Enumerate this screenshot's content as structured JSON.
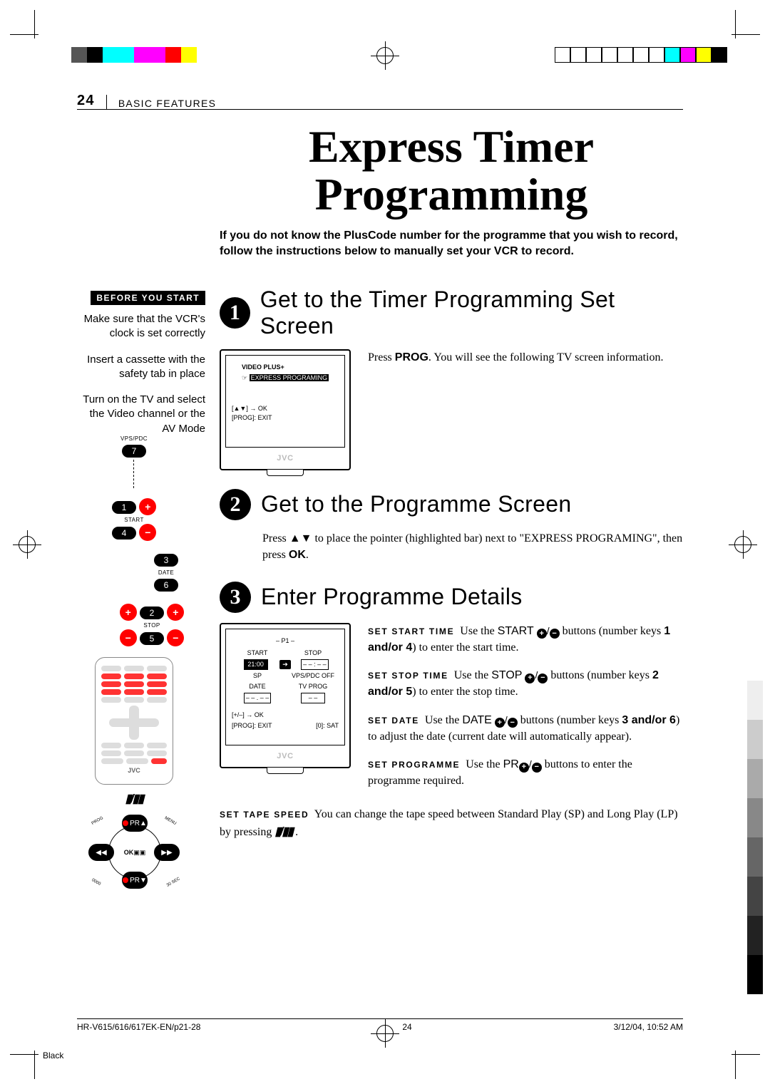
{
  "page_number": "24",
  "section": "BASIC FEATURES",
  "title_line1": "Express Timer",
  "title_line2": "Programming",
  "intro": "If you do not know the PlusCode number for the programme that you wish to record, follow the instructions below to manually set your VCR to record.",
  "before": {
    "badge": "BEFORE YOU START",
    "items": [
      "Make sure that the VCR's clock is set correctly",
      "Insert a cassette with the safety tab in place",
      "Turn on the TV and select the Video channel or the AV Mode"
    ]
  },
  "steps": {
    "s1": {
      "num": "1",
      "title": "Get to the Timer Programming Set Screen",
      "body_pre": "Press ",
      "body_kw": "PROG",
      "body_post": ". You will see the following TV screen information."
    },
    "s2": {
      "num": "2",
      "title": "Get to the Programme Screen",
      "body_pre": "Press ",
      "arrows": "▲▼",
      "body_mid": " to place the pointer (highlighted bar) next to \"EXPRESS PROGRAMING\", then press ",
      "ok": "OK",
      "body_post": "."
    },
    "s3": {
      "num": "3",
      "title": "Enter Programme Details",
      "start": {
        "label": "SET START TIME",
        "pre": "Use the  ",
        "btn": "START",
        "post": " buttons (number keys ",
        "keys": "1 and/or 4",
        "tail": ") to enter the start time."
      },
      "stop": {
        "label": "SET STOP TIME",
        "pre": "Use the ",
        "btn": "STOP",
        "post": " buttons (number keys ",
        "keys": "2 and/or 5",
        "tail": ") to enter the stop time."
      },
      "date": {
        "label": "SET DATE",
        "pre": "Use the ",
        "btn": "DATE",
        "post": " buttons (number keys ",
        "keys": "3 and/or 6",
        "tail": ") to adjust the date (current date will automatically appear)."
      },
      "prog": {
        "label": "SET PROGRAMME",
        "pre": "Use the ",
        "btn": "PR",
        "post": " buttons to enter the programme required."
      },
      "tape": {
        "label": "SET TAPE SPEED",
        "text": "You can change the tape speed between Standard Play (SP) and Long Play (LP) by pressing "
      }
    }
  },
  "tv1": {
    "title": "VIDEO PLUS+",
    "row_hl": "EXPRESS PROGRAMING",
    "hint1": "[▲▼] → OK",
    "hint2": "[PROG]: EXIT",
    "brand": "JVC"
  },
  "tv2": {
    "prog": "– P1 –",
    "c_start": "START",
    "c_stop": "STOP",
    "start_val": "21:00",
    "stop_val": "– – : – –",
    "arrow": "➔",
    "sp": "SP",
    "vps": "VPS/PDC OFF",
    "date": "DATE",
    "tvprog": "TV PROG",
    "date_val": "– – . – –",
    "tv_val": "– –",
    "hint1": "[+/–] → OK",
    "hint2": "[PROG]: EXIT",
    "hint3": "[0]: SAT",
    "brand": "JVC"
  },
  "remote": {
    "vpspdc": "VPS/PDC",
    "b7": "7",
    "b1": "1",
    "start": "START",
    "b4": "4",
    "b3": "3",
    "date": "DATE",
    "b6": "6",
    "b2": "2",
    "stop": "STOP",
    "b5": "5",
    "brand": "JVC",
    "nav": {
      "ok": "OK",
      "pr_plus": "PR",
      "pr_minus": "PR",
      "rew": "◀◀",
      "ff": "▶▶",
      "prog_lbl": "PROG",
      "menu_lbl": "MENU",
      "zero_lbl": "0000",
      "sec_lbl": "30 SEC"
    }
  },
  "footer": {
    "left": "HR-V615/616/617EK-EN/p21-28",
    "mid": "24",
    "right": "3/12/04, 10:52 AM",
    "black": "Black"
  },
  "colors": {
    "bar1": [
      "#555",
      "#000",
      "#0ff",
      "#0ff",
      "#f0f",
      "#f0f",
      "#f00",
      "#ff0"
    ],
    "bar2": [
      "#fff",
      "#fff",
      "#fff",
      "#fff",
      "#fff",
      "#fff",
      "#fff",
      "#0ff",
      "#f0f",
      "#ff0",
      "#000"
    ],
    "grey": [
      "#fff",
      "#eee",
      "#ccc",
      "#aaa",
      "#888",
      "#666",
      "#444",
      "#222",
      "#000"
    ]
  }
}
